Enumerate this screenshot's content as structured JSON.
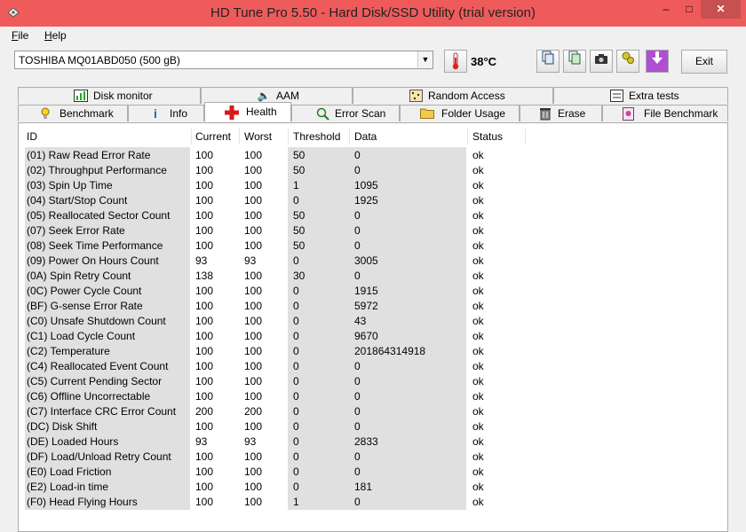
{
  "window": {
    "title": "HD Tune Pro 5.50 - Hard Disk/SSD Utility (trial version)"
  },
  "menu": {
    "file": "File",
    "help": "Help"
  },
  "toolbar": {
    "drive": "TOSHIBA MQ01ABD050 (500 gB)",
    "temperature": "38°C",
    "exit_label": "Exit",
    "icons": [
      "copy-info-icon",
      "copy-all-icon",
      "camera-icon",
      "options-icon",
      "download-icon"
    ]
  },
  "tabs_top": [
    {
      "label": "Disk monitor",
      "icon": "disk-monitor-icon"
    },
    {
      "label": "AAM",
      "icon": "speaker-icon"
    },
    {
      "label": "Random Access",
      "icon": "random-access-icon"
    },
    {
      "label": "Extra tests",
      "icon": "extra-tests-icon"
    }
  ],
  "tabs_bottom": [
    {
      "label": "Benchmark",
      "icon": "benchmark-icon"
    },
    {
      "label": "Info",
      "icon": "info-icon"
    },
    {
      "label": "Health",
      "icon": "health-icon",
      "active": true
    },
    {
      "label": "Error Scan",
      "icon": "error-scan-icon"
    },
    {
      "label": "Folder Usage",
      "icon": "folder-icon"
    },
    {
      "label": "Erase",
      "icon": "erase-icon"
    },
    {
      "label": "File Benchmark",
      "icon": "file-benchmark-icon"
    }
  ],
  "columns": [
    "ID",
    "Current",
    "Worst",
    "Threshold",
    "Data",
    "Status"
  ],
  "rows": [
    [
      "(01) Raw Read Error Rate",
      "100",
      "100",
      "50",
      "0",
      "ok"
    ],
    [
      "(02) Throughput Performance",
      "100",
      "100",
      "50",
      "0",
      "ok"
    ],
    [
      "(03) Spin Up Time",
      "100",
      "100",
      "1",
      "1095",
      "ok"
    ],
    [
      "(04) Start/Stop Count",
      "100",
      "100",
      "0",
      "1925",
      "ok"
    ],
    [
      "(05) Reallocated Sector Count",
      "100",
      "100",
      "50",
      "0",
      "ok"
    ],
    [
      "(07) Seek Error Rate",
      "100",
      "100",
      "50",
      "0",
      "ok"
    ],
    [
      "(08) Seek Time Performance",
      "100",
      "100",
      "50",
      "0",
      "ok"
    ],
    [
      "(09) Power On Hours Count",
      "93",
      "93",
      "0",
      "3005",
      "ok"
    ],
    [
      "(0A) Spin Retry Count",
      "138",
      "100",
      "30",
      "0",
      "ok"
    ],
    [
      "(0C) Power Cycle Count",
      "100",
      "100",
      "0",
      "1915",
      "ok"
    ],
    [
      "(BF) G-sense Error Rate",
      "100",
      "100",
      "0",
      "5972",
      "ok"
    ],
    [
      "(C0) Unsafe Shutdown Count",
      "100",
      "100",
      "0",
      "43",
      "ok"
    ],
    [
      "(C1) Load Cycle Count",
      "100",
      "100",
      "0",
      "9670",
      "ok"
    ],
    [
      "(C2) Temperature",
      "100",
      "100",
      "0",
      "201864314918",
      "ok"
    ],
    [
      "(C4) Reallocated Event Count",
      "100",
      "100",
      "0",
      "0",
      "ok"
    ],
    [
      "(C5) Current Pending Sector",
      "100",
      "100",
      "0",
      "0",
      "ok"
    ],
    [
      "(C6) Offline Uncorrectable",
      "100",
      "100",
      "0",
      "0",
      "ok"
    ],
    [
      "(C7) Interface CRC Error Count",
      "200",
      "200",
      "0",
      "0",
      "ok"
    ],
    [
      "(DC) Disk Shift",
      "100",
      "100",
      "0",
      "0",
      "ok"
    ],
    [
      "(DE) Loaded Hours",
      "93",
      "93",
      "0",
      "2833",
      "ok"
    ],
    [
      "(DF) Load/Unload Retry Count",
      "100",
      "100",
      "0",
      "0",
      "ok"
    ],
    [
      "(E0) Load Friction",
      "100",
      "100",
      "0",
      "0",
      "ok"
    ],
    [
      "(E2) Load-in time",
      "100",
      "100",
      "0",
      "181",
      "ok"
    ],
    [
      "(F0) Head Flying Hours",
      "100",
      "100",
      "1",
      "0",
      "ok"
    ]
  ]
}
